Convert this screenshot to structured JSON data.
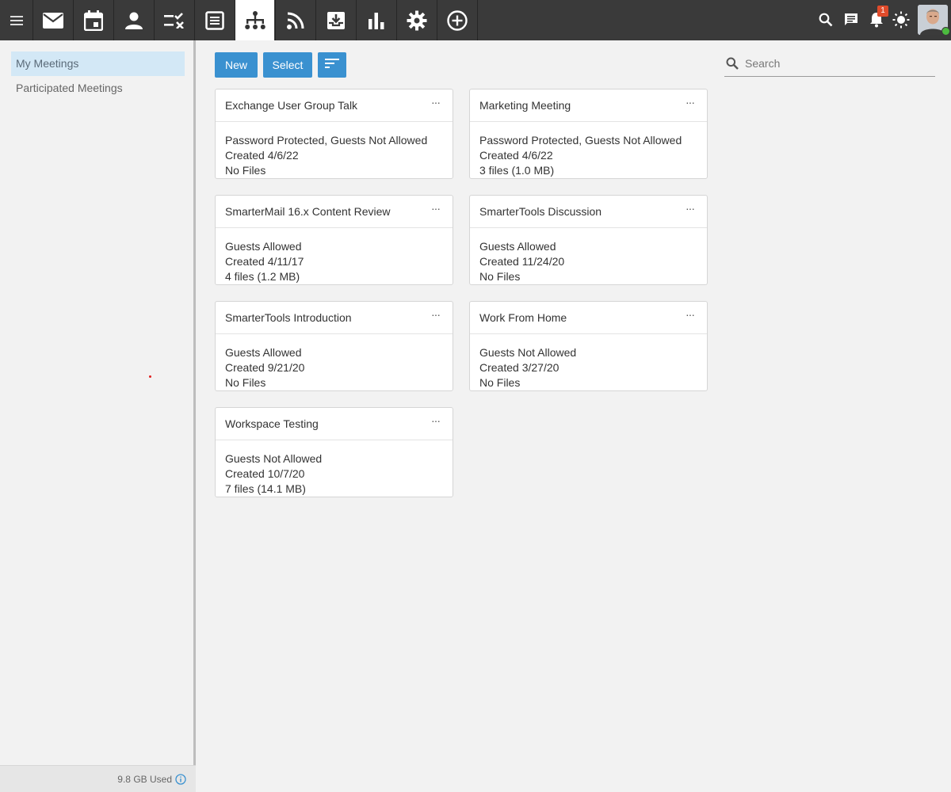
{
  "topbar": {
    "tabs": [
      {
        "name": "mail-icon"
      },
      {
        "name": "calendar-icon"
      },
      {
        "name": "contacts-icon"
      },
      {
        "name": "tasks-icon"
      },
      {
        "name": "notes-icon"
      },
      {
        "name": "meetings-icon"
      },
      {
        "name": "rss-icon"
      },
      {
        "name": "file-storage-icon"
      },
      {
        "name": "reports-icon"
      },
      {
        "name": "settings-icon"
      },
      {
        "name": "add-icon"
      }
    ],
    "active_tab": "meetings-icon",
    "notification_count": "1",
    "accent_color": "#3a91d0"
  },
  "sidebar": {
    "items": [
      {
        "label": "My Meetings"
      },
      {
        "label": "Participated Meetings"
      }
    ],
    "storage_used": "9.8 GB Used"
  },
  "toolbar": {
    "new_label": "New",
    "select_label": "Select",
    "search_placeholder": "Search"
  },
  "meetings": [
    {
      "title": "Exchange User Group Talk",
      "access": "Password Protected, Guests Not Allowed",
      "created": "Created 4/6/22",
      "files": "No Files"
    },
    {
      "title": "Marketing Meeting",
      "access": "Password Protected, Guests Not Allowed",
      "created": "Created 4/6/22",
      "files": "3 files (1.0 MB)"
    },
    {
      "title": "SmarterMail 16.x Content Review",
      "access": "Guests Allowed",
      "created": "Created 4/11/17",
      "files": "4 files (1.2 MB)"
    },
    {
      "title": "SmarterTools Discussion",
      "access": "Guests Allowed",
      "created": "Created 11/24/20",
      "files": "No Files"
    },
    {
      "title": "SmarterTools Introduction",
      "access": "Guests Allowed",
      "created": "Created 9/21/20",
      "files": "No Files"
    },
    {
      "title": "Work From Home",
      "access": "Guests Not Allowed",
      "created": "Created 3/27/20",
      "files": "No Files"
    },
    {
      "title": "Workspace Testing",
      "access": "Guests Not Allowed",
      "created": "Created 10/7/20",
      "files": "7 files (14.1 MB)"
    }
  ]
}
